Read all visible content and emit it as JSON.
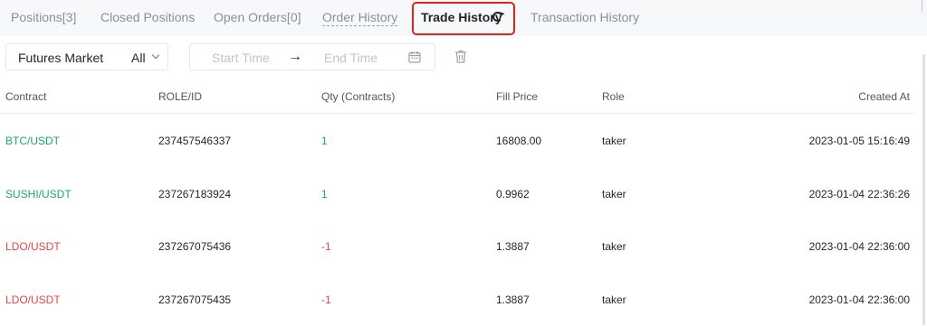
{
  "tabs": [
    {
      "label": "Positions[3]"
    },
    {
      "label": "Closed Positions"
    },
    {
      "label": "Open Orders[0]"
    },
    {
      "label": "Order History"
    },
    {
      "label": "Trade History"
    },
    {
      "label": "Transaction History"
    }
  ],
  "active_tab": "Trade History",
  "filters": {
    "market_label": "Futures Market",
    "market_value": "All",
    "start_placeholder": "Start Time",
    "range_arrow": "→",
    "end_placeholder": "End Time"
  },
  "table": {
    "headers": [
      "Contract",
      "ROLE/ID",
      "Qty (Contracts)",
      "Fill Price",
      "Role",
      "Created At"
    ],
    "rows": [
      {
        "contract": "BTC/USDT",
        "id": "237457546337",
        "qty": "1",
        "price": "16808.00",
        "role": "taker",
        "created": "2023-01-05 15:16:49",
        "side": "buy"
      },
      {
        "contract": "SUSHI/USDT",
        "id": "237267183924",
        "qty": "1",
        "price": "0.9962",
        "role": "taker",
        "created": "2023-01-04 22:36:26",
        "side": "buy"
      },
      {
        "contract": "LDO/USDT",
        "id": "237267075436",
        "qty": "-1",
        "price": "1.3887",
        "role": "taker",
        "created": "2023-01-04 22:36:00",
        "side": "sell"
      },
      {
        "contract": "LDO/USDT",
        "id": "237267075435",
        "qty": "-1",
        "price": "1.3887",
        "role": "taker",
        "created": "2023-01-04 22:36:00",
        "side": "sell"
      }
    ]
  },
  "colors": {
    "buy": "#1fa37a",
    "sell": "#e04848",
    "highlight": "#e0231c"
  }
}
